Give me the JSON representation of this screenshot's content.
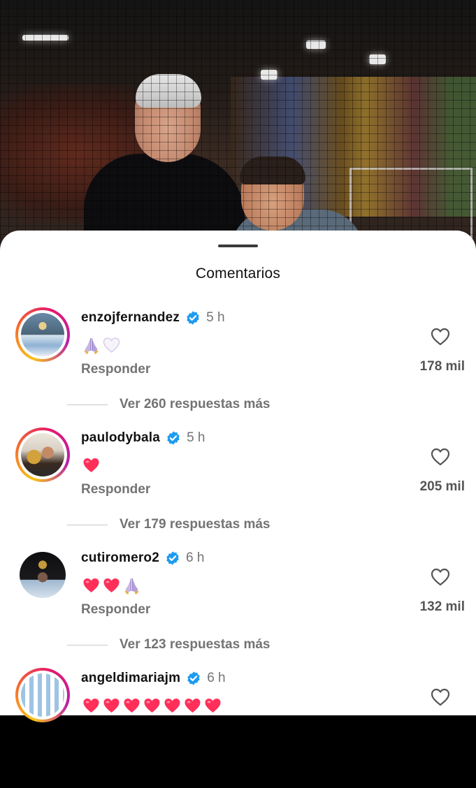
{
  "sheet": {
    "title": "Comentarios"
  },
  "comments": [
    {
      "username": "enzojfernandez",
      "time": "5 h",
      "emojis": [
        "pray",
        "white-heart"
      ],
      "reply_label": "Responder",
      "likes": "178 mil",
      "view_replies": "Ver 260 respuestas más"
    },
    {
      "username": "paulodybala",
      "time": "5 h",
      "emojis": [
        "red-heart"
      ],
      "reply_label": "Responder",
      "likes": "205 mil",
      "view_replies": "Ver 179 respuestas más"
    },
    {
      "username": "cutiromero2",
      "time": "6 h",
      "emojis": [
        "red-heart",
        "red-heart",
        "pray"
      ],
      "reply_label": "Responder",
      "likes": "132 mil",
      "view_replies": "Ver 123 respuestas más"
    },
    {
      "username": "angeldimariajm",
      "time": "6 h",
      "emojis": [
        "red-heart",
        "red-heart",
        "red-heart",
        "red-heart",
        "red-heart",
        "red-heart",
        "red-heart"
      ]
    }
  ],
  "colors": {
    "verified": "#1d9bf0",
    "heart": "#ff2f5a",
    "secondary_text": "#737373"
  }
}
